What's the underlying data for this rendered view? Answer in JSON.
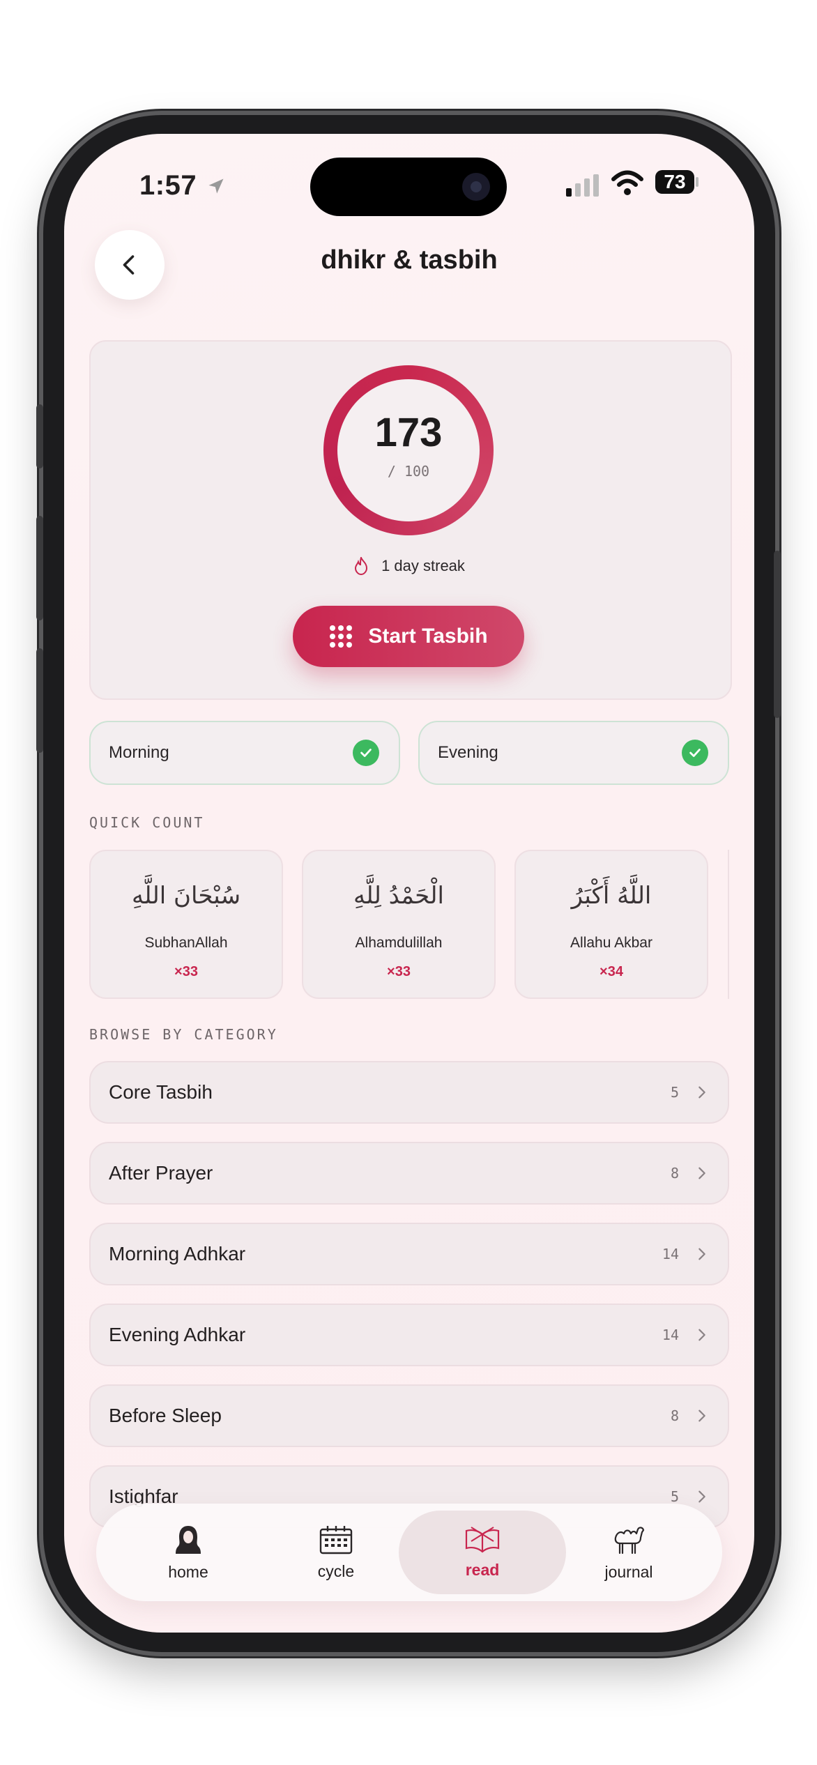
{
  "status_bar": {
    "time": "1:57",
    "battery": "73"
  },
  "header": {
    "title": "dhikr & tasbih"
  },
  "counter": {
    "count": "173",
    "goal": "/ 100",
    "progress": 1.0,
    "streak": "1 day streak",
    "start_label": "Start Tasbih"
  },
  "adhkar_status": [
    {
      "label": "Morning",
      "done": true
    },
    {
      "label": "Evening",
      "done": true
    }
  ],
  "quick_count": {
    "section_label": "QUICK COUNT",
    "items": [
      {
        "arabic": "سُبْحَانَ اللَّهِ",
        "name": "SubhanAllah",
        "count": "×33"
      },
      {
        "arabic": "الْحَمْدُ لِلَّهِ",
        "name": "Alhamdulillah",
        "count": "×33"
      },
      {
        "arabic": "اللَّهُ أَكْبَرُ",
        "name": "Allahu Akbar",
        "count": "×34"
      }
    ]
  },
  "categories": {
    "section_label": "BROWSE BY CATEGORY",
    "items": [
      {
        "title": "Core Tasbih",
        "count": "5"
      },
      {
        "title": "After Prayer",
        "count": "8"
      },
      {
        "title": "Morning Adhkar",
        "count": "14"
      },
      {
        "title": "Evening Adhkar",
        "count": "14"
      },
      {
        "title": "Before Sleep",
        "count": "8"
      },
      {
        "title": "Istighfar",
        "count": "5"
      }
    ]
  },
  "nav": {
    "items": [
      {
        "label": "home",
        "icon": "hijab-woman-icon"
      },
      {
        "label": "cycle",
        "icon": "calendar-icon"
      },
      {
        "label": "read",
        "icon": "open-book-icon",
        "active": true
      },
      {
        "label": "journal",
        "icon": "camel-icon"
      }
    ]
  },
  "colors": {
    "accent": "#c8254e",
    "success": "#3cb95f",
    "background": "#fdf2f4"
  }
}
